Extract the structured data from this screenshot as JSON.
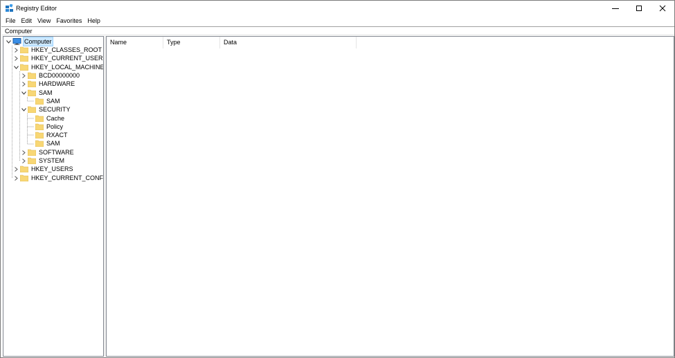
{
  "window": {
    "title": "Registry Editor"
  },
  "icons": {
    "app": "registry-editor-icon",
    "minimize": "minimize-icon",
    "maximize": "maximize-icon",
    "close": "close-icon",
    "folder": "folder-icon",
    "computer": "computer-icon",
    "expand": "chevron-right-icon",
    "collapse": "chevron-down-icon"
  },
  "colors": {
    "folder": "#f8d775",
    "selection": "#cce8ff",
    "computer": "#3a8ee6"
  },
  "menu": {
    "file": "File",
    "edit": "Edit",
    "view": "View",
    "favorites": "Favorites",
    "help": "Help"
  },
  "address": {
    "value": "Computer"
  },
  "tree": {
    "computer": "Computer",
    "hkcr": "HKEY_CLASSES_ROOT",
    "hkcu": "HKEY_CURRENT_USER",
    "hklm": "HKEY_LOCAL_MACHINE",
    "bcd": "BCD00000000",
    "hardware": "HARDWARE",
    "sam": "SAM",
    "sam_child": "SAM",
    "security": "SECURITY",
    "cache": "Cache",
    "policy": "Policy",
    "rxact": "RXACT",
    "security_sam": "SAM",
    "software": "SOFTWARE",
    "system": "SYSTEM",
    "hku": "HKEY_USERS",
    "hkcc": "HKEY_CURRENT_CONFIG"
  },
  "list": {
    "col_name": "Name",
    "col_type": "Type",
    "col_data": "Data"
  }
}
